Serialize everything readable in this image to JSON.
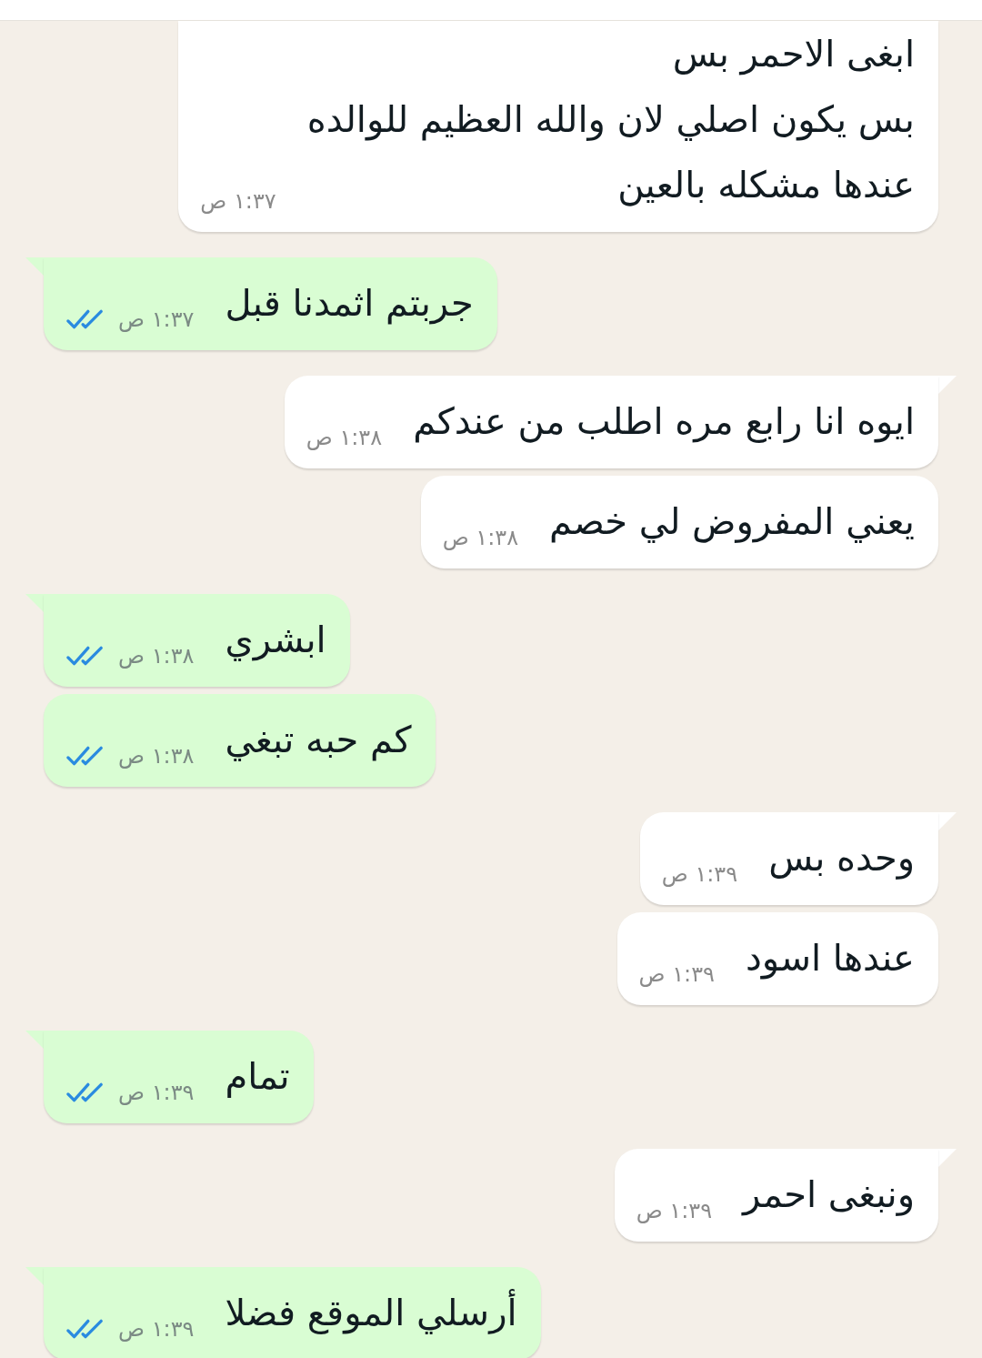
{
  "messages": [
    {
      "kind": "incoming",
      "tail": false,
      "lines": [
        "ابغى الاحمر بس",
        "بس يكون اصلي لان والله العظيم للوالده",
        "عندها مشكله بالعين"
      ],
      "time": "١:٣٧ ص"
    },
    {
      "kind": "outgoing",
      "tail": true,
      "lines": [
        "جربتم اثمدنا قبل"
      ],
      "time": "١:٣٧ ص",
      "read": true
    },
    {
      "kind": "incoming",
      "tail": true,
      "lines": [
        "ايوه انا رابع مره اطلب من عندكم"
      ],
      "time": "١:٣٨ ص"
    },
    {
      "kind": "incoming",
      "tail": false,
      "lines": [
        "يعني المفروض لي خصم"
      ],
      "time": "١:٣٨ ص"
    },
    {
      "kind": "outgoing",
      "tail": true,
      "lines": [
        "ابشري"
      ],
      "time": "١:٣٨ ص",
      "read": true
    },
    {
      "kind": "outgoing",
      "tail": false,
      "lines": [
        "كم حبه تبغي"
      ],
      "time": "١:٣٨ ص",
      "read": true
    },
    {
      "kind": "incoming",
      "tail": true,
      "lines": [
        "وحده بس"
      ],
      "time": "١:٣٩ ص"
    },
    {
      "kind": "incoming",
      "tail": false,
      "lines": [
        "عندها اسود"
      ],
      "time": "١:٣٩ ص"
    },
    {
      "kind": "outgoing",
      "tail": true,
      "lines": [
        "تمام"
      ],
      "time": "١:٣٩ ص",
      "read": true
    },
    {
      "kind": "incoming",
      "tail": true,
      "lines": [
        "ونبغى احمر"
      ],
      "time": "١:٣٩ ص"
    },
    {
      "kind": "outgoing",
      "tail": true,
      "lines": [
        "أرسلي الموقع فضلا"
      ],
      "time": "١:٣٩ ص",
      "read": true
    }
  ]
}
